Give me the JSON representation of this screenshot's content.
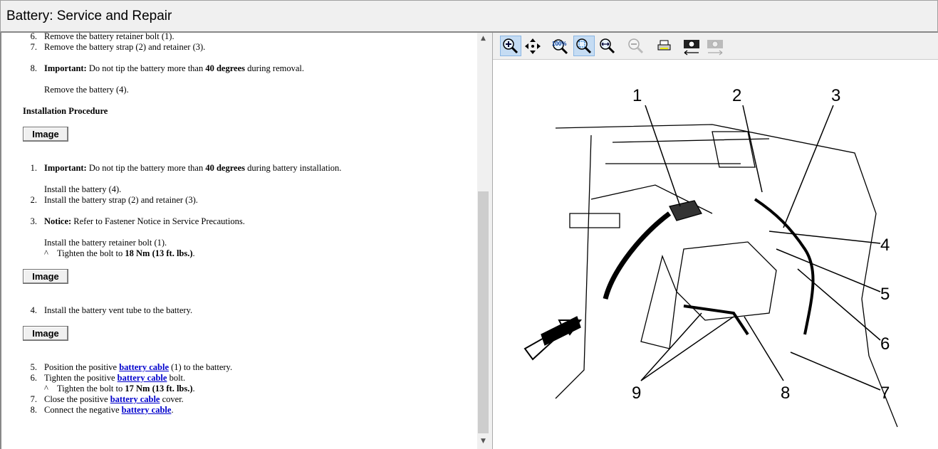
{
  "window": {
    "title": "Battery:  Service and Repair"
  },
  "removal_steps": [
    {
      "n": "6.",
      "text": "Remove the battery retainer bolt (1)."
    },
    {
      "n": "7.",
      "text": "Remove the battery strap (2) and retainer (3)."
    },
    {
      "n": "8.",
      "important": "Important:",
      "pre": " Do not tip the battery more than ",
      "bold": "40 degrees",
      "post": " during removal.",
      "sub": "Remove the battery (4)."
    }
  ],
  "installation": {
    "heading": "Installation Procedure",
    "image_button": "Image",
    "s1": {
      "n": "1.",
      "important": "Important:",
      "pre": " Do not tip the battery more than ",
      "bold": "40 degrees",
      "post": " during battery installation.",
      "sub": "Install the battery (4)."
    },
    "s2": {
      "n": "2.",
      "text": "Install the battery strap (2) and retainer (3)."
    },
    "s3": {
      "n": "3.",
      "important": "Notice:",
      "post": " Refer to Fastener Notice in Service Precautions.",
      "sub": "Install the battery retainer bolt (1).",
      "caret": "^",
      "tighten_pre": "Tighten the bolt to ",
      "tighten_bold": "18 Nm (13 ft. lbs.)",
      "tighten_post": "."
    },
    "s4": {
      "n": "4.",
      "text": "Install the battery vent tube to the battery."
    },
    "s5": {
      "n": "5.",
      "pre": "Position the positive ",
      "link": "battery cable",
      "post": " (1) to the battery."
    },
    "s6": {
      "n": "6.",
      "pre": "Tighten the positive ",
      "link": "battery cable",
      "post": " bolt.",
      "caret": "^",
      "tighten_pre": "Tighten the bolt to ",
      "tighten_bold": "17 Nm (13 ft. lbs.)",
      "tighten_post": "."
    },
    "s7": {
      "n": "7.",
      "pre": "Close the positive ",
      "link": "battery cable",
      "post": " cover."
    },
    "s8": {
      "n": "8.",
      "pre": "Connect the negative ",
      "link": "battery cable",
      "post": "."
    }
  },
  "toolbar": {
    "items": [
      "zoom-in",
      "pan",
      "actual-size-100%",
      "fit-to-window",
      "fit-width",
      "zoom-out",
      "print",
      "previous-image",
      "next-image"
    ],
    "zoom_100_label": "100%"
  },
  "diagram": {
    "callouts": [
      "1",
      "2",
      "3",
      "4",
      "5",
      "6",
      "7",
      "8",
      "9"
    ]
  }
}
